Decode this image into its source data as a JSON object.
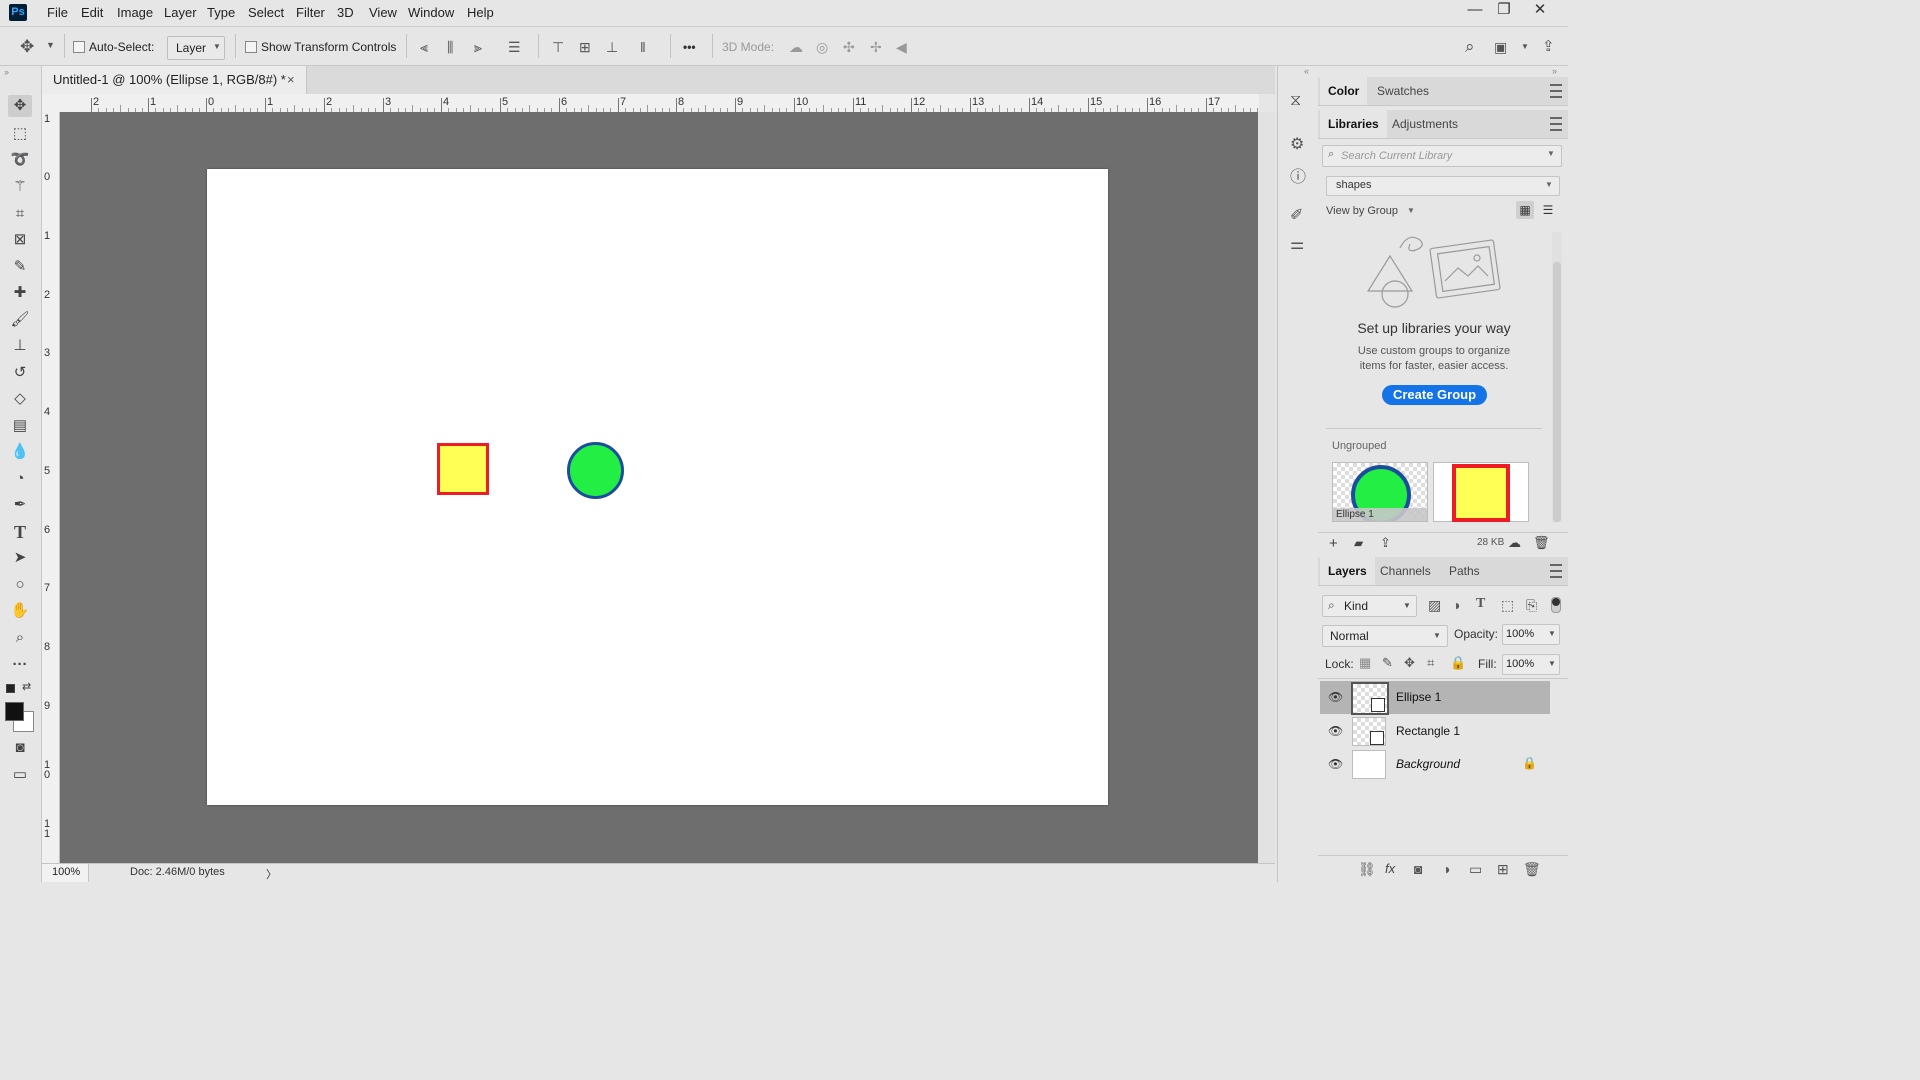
{
  "app": {
    "logo": "Ps"
  },
  "menu": [
    "File",
    "Edit",
    "Image",
    "Layer",
    "Type",
    "Select",
    "Filter",
    "3D",
    "View",
    "Window",
    "Help"
  ],
  "window_controls": {
    "minimize": "—",
    "restore": "❐",
    "close": "✕"
  },
  "options": {
    "auto_select_label": "Auto-Select:",
    "layer_select_value": "Layer",
    "show_transform_label": "Show Transform Controls",
    "more": "•••",
    "mode_3d_label": "3D Mode:"
  },
  "document": {
    "tab_title": "Untitled-1 @ 100% (Ellipse 1, RGB/8#) *",
    "tab_close": "×",
    "zoom": "100%",
    "doc_info": "Doc: 2.46M/0 bytes",
    "status_arrow": "〉"
  },
  "rulers": {
    "top": [
      "2",
      "1",
      "0",
      "1",
      "2",
      "3",
      "4",
      "5",
      "6",
      "7",
      "8",
      "9",
      "10",
      "11",
      "12",
      "13",
      "14",
      "15",
      "16",
      "17"
    ],
    "left": [
      "1",
      "0",
      "1",
      "2",
      "3",
      "4",
      "5",
      "6",
      "7",
      "8",
      "9",
      "1 0",
      "1 1"
    ]
  },
  "colors": {
    "rect_fill": "#ffff55",
    "rect_stroke": "#ee1c24",
    "ellipse_fill": "#22ee44",
    "ellipse_stroke": "#1a4d9e",
    "accent_button": "#1473e6",
    "canvas_bg": "#6e6e6e"
  },
  "color_panel": {
    "tabs": [
      "Color",
      "Swatches"
    ]
  },
  "libraries": {
    "tabs": [
      "Libraries",
      "Adjustments"
    ],
    "search_placeholder": "Search Current Library",
    "library_name": "shapes",
    "view_by": "View by Group",
    "empty_title": "Set up libraries your way",
    "empty_desc_1": "Use custom groups to organize",
    "empty_desc_2": "items for faster, easier access.",
    "create_group": "Create Group",
    "ungrouped_label": "Ungrouped",
    "item_ellipse_label": "Ellipse 1",
    "size": "28 KB"
  },
  "layers_panel": {
    "tabs": [
      "Layers",
      "Channels",
      "Paths"
    ],
    "filter_kind": "Kind",
    "blend_mode": "Normal",
    "opacity_label": "Opacity:",
    "opacity_value": "100%",
    "lock_label": "Lock:",
    "fill_label": "Fill:",
    "fill_value": "100%",
    "layers": [
      {
        "name": "Ellipse 1"
      },
      {
        "name": "Rectangle 1"
      },
      {
        "name": "Background"
      }
    ],
    "footer_fx": "fx"
  }
}
